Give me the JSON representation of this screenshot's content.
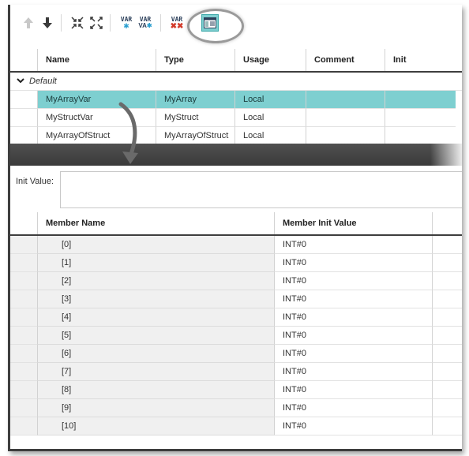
{
  "toolbar": {
    "buttons": [
      {
        "icon": "move-up-icon"
      },
      {
        "icon": "move-down-icon"
      },
      {
        "icon": "collapse-all-icon"
      },
      {
        "icon": "expand-all-icon"
      },
      {
        "icon": "add-variable-icon",
        "label": "VAR"
      },
      {
        "icon": "add-variable-in-out-icon",
        "label": "VAR"
      },
      {
        "icon": "delete-variable-icon",
        "label": "VAR"
      },
      {
        "icon": "detail-view-icon"
      }
    ]
  },
  "var_grid": {
    "columns": [
      "Name",
      "Type",
      "Usage",
      "Comment",
      "Init"
    ],
    "group": "Default",
    "rows": [
      {
        "name": "MyArrayVar",
        "type": "MyArray",
        "usage": "Local",
        "comment": "",
        "init": ""
      },
      {
        "name": "MyStructVar",
        "type": "MyStruct",
        "usage": "Local",
        "comment": "",
        "init": ""
      },
      {
        "name": "MyArrayOfStruct",
        "type": "MyArrayOfStruct",
        "usage": "Local",
        "comment": "",
        "init": ""
      }
    ],
    "selected_index": 0
  },
  "init_panel": {
    "label": "Init Value:",
    "value": ""
  },
  "member_grid": {
    "columns": [
      "Member Name",
      "Member Init Value"
    ],
    "rows": [
      {
        "name": "[0]",
        "value": "INT#0"
      },
      {
        "name": "[1]",
        "value": "INT#0"
      },
      {
        "name": "[2]",
        "value": "INT#0"
      },
      {
        "name": "[3]",
        "value": "INT#0"
      },
      {
        "name": "[4]",
        "value": "INT#0"
      },
      {
        "name": "[5]",
        "value": "INT#0"
      },
      {
        "name": "[6]",
        "value": "INT#0"
      },
      {
        "name": "[7]",
        "value": "INT#0"
      },
      {
        "name": "[8]",
        "value": "INT#0"
      },
      {
        "name": "[9]",
        "value": "INT#0"
      },
      {
        "name": "[10]",
        "value": "INT#0"
      }
    ]
  },
  "colors": {
    "selection": "#7ecfd0",
    "splitter": "#444444",
    "accent": "#3aa7a8"
  }
}
